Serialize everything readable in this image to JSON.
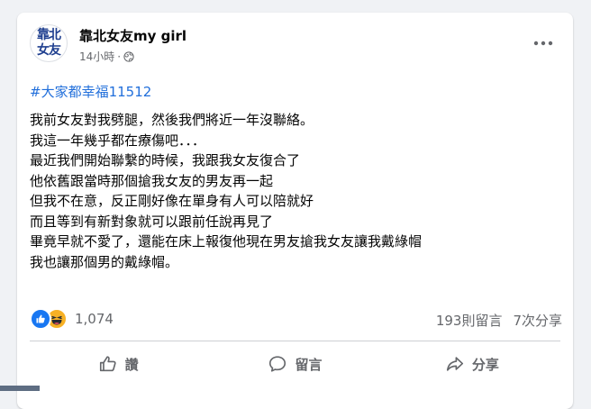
{
  "post": {
    "avatar_text_line1": "靠北",
    "avatar_text_line2": "女友",
    "author": "靠北女友my girl",
    "time": "14小時",
    "dot": "·",
    "hashtag": "#大家都幸福11512",
    "lines": [
      "我前女友對我劈腿，然後我們將近一年沒聯絡。",
      "我這一年幾乎都在療傷吧．．．",
      "最近我們開始聯繫的時候，我跟我女友復合了",
      "他依舊跟當時那個搶我女友的男友再一起",
      "但我不在意，反正剛好像在單身有人可以陪就好",
      "而且等到有新對象就可以跟前任說再見了",
      "畢竟早就不愛了，還能在床上報復他現在男友搶我女友讓我戴綠帽",
      "我也讓那個男的戴綠帽。"
    ]
  },
  "engagement": {
    "reaction_count": "1,074",
    "comments": "193則留言",
    "shares": "7次分享"
  },
  "actions": {
    "like_label": "讚",
    "comment_label": "留言",
    "share_label": "分享"
  },
  "icons": {
    "globe": "globe-icon",
    "more": "more-options-icon",
    "like_reaction": "like-reaction-icon",
    "haha_reaction": "haha-reaction-icon",
    "like": "thumbs-up-icon",
    "comment": "comment-bubble-icon",
    "share": "share-arrow-icon"
  },
  "colors": {
    "link": "#216fdb",
    "text": "#050505",
    "secondary": "#65676b",
    "like_blue": "#1877f2",
    "haha_yellow": "#f7b125",
    "avatar_blue": "#1f3f8f"
  }
}
